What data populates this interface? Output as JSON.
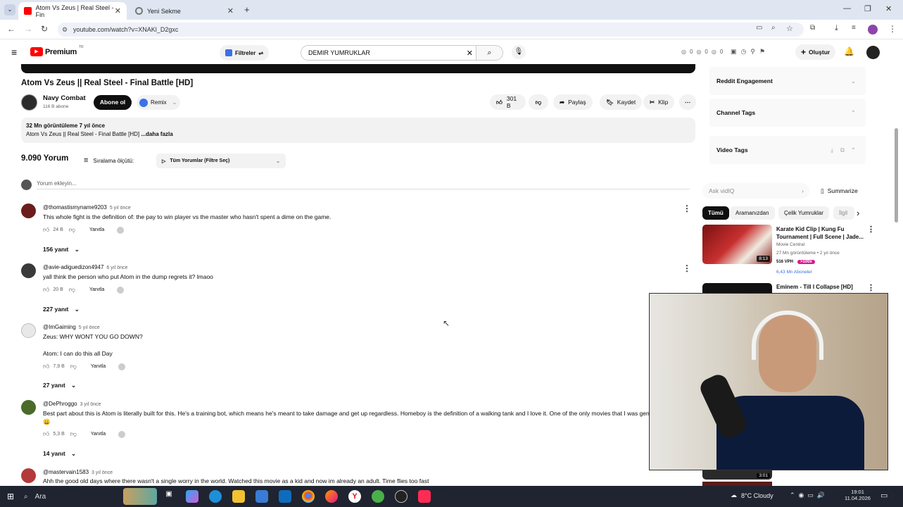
{
  "browser": {
    "tabs": [
      {
        "title": "Atom Vs Zeus | Real Steel - Fin",
        "active": true
      },
      {
        "title": "Yeni Sekme",
        "active": false
      }
    ],
    "url": "youtube.com/watch?v=XNAKl_D2gxc"
  },
  "yt_header": {
    "logo": "Premium",
    "logo_sup": "TR",
    "filters_label": "Filtreler",
    "search_value": "DEMIR YUMRUKLAR",
    "counters": [
      "0",
      "0",
      "0"
    ],
    "create_label": "Oluştur"
  },
  "video": {
    "title": "Atom Vs Zeus || Real Steel - Final Battle [HD]",
    "channel": "Navy Combat",
    "subs": "116 B abone",
    "subscribe_label": "Abone ol",
    "remix_label": "Remix",
    "likes": "301 B",
    "share_label": "Paylaş",
    "save_label": "Kaydet",
    "clip_label": "Klip",
    "views_line": "32 Mn görüntüleme  7 yıl önce",
    "desc_line": "Atom Vs Zeus || Real Steel - Final Battle [HD]",
    "more_label": "...daha fazla"
  },
  "comments_section": {
    "count_label": "9.090 Yorum",
    "sort_label": "Sıralama ölçütü:",
    "filter_label": "Tüm Yorumlar (Filtre Seç)",
    "add_placeholder": "Yorum ekleyin...",
    "reply_label": "Yanıtla",
    "items": [
      {
        "user": "@thomastismyname9203",
        "time": "5 yıl önce",
        "text": "This whole fight is the definition of: the pay to win player vs the master who hasn't spent a dime on the game.",
        "text2": "",
        "likes": "24 B",
        "replies": "156 yanıt"
      },
      {
        "user": "@avie-adiguedizon4947",
        "time": "6 yıl önce",
        "text": "yall think the person who put Atom in the dump regrets it? lmaoo",
        "text2": "",
        "likes": "20 B",
        "replies": "227 yanıt"
      },
      {
        "user": "@ImGaiming",
        "time": "5 yıl önce",
        "text": "Zeus: WHY WONT YOU GO DOWN?",
        "text2": "Atom: I can do this all Day",
        "likes": "7,9 B",
        "replies": "27 yanıt"
      },
      {
        "user": "@DePhroggo",
        "time": "3 yıl önce",
        "text": "Best part about this is Atom is literally built for this. He's a training bot, which means he's meant to take damage and get up regardless. Homeboy is the definition of a walking tank and I love it. One of the only movies that I was genuin",
        "text2": "😀",
        "likes": "5,3 B",
        "replies": "14 yanıt"
      },
      {
        "user": "@mastervain1583",
        "time": "3 yıl önce",
        "text": "Ahh the good old days where there wasn't a single worry in the world. Watched this movie as a kid and now im already an adult. Time flies too fast",
        "text2": "",
        "likes": "",
        "replies": ""
      }
    ]
  },
  "sidebar": {
    "panels": [
      "Reddit Engagement",
      "Channel Tags",
      "Video Tags"
    ],
    "ask_placeholder": "Ask vidIQ",
    "summarize_label": "Summarize",
    "chips": [
      "Tümü",
      "Aramanızdan",
      "Çelik Yumruklar",
      "İlgil"
    ],
    "videos": [
      {
        "title": "Karate Kid Clip | Kung Fu Tournament | Full Scene | Jade...",
        "channel": "Movie Central",
        "meta": "27 Mn görüntüleme • 2 yıl önce",
        "vph": "516 VPH",
        "badge": ">100x",
        "subs": "6,43 Mn Aboneler",
        "duration": "8:13"
      },
      {
        "title": "Eminem - Till I Collapse [HD]",
        "channel": "",
        "meta": "",
        "vph": "",
        "badge": "",
        "subs": "",
        "duration": "3:01"
      }
    ]
  },
  "taskbar": {
    "search_label": "Ara",
    "weather": "8°C Cloudy",
    "time": "19:01",
    "date": "11.04.2026"
  },
  "colors": {
    "yt_red": "#ff0000",
    "chrome_tab_bg": "#dfe6f2",
    "taskbar_bg": "#1f2430",
    "subscribe_bg": "#0f0f0f",
    "vidiq_blue": "#3d6fe8"
  }
}
